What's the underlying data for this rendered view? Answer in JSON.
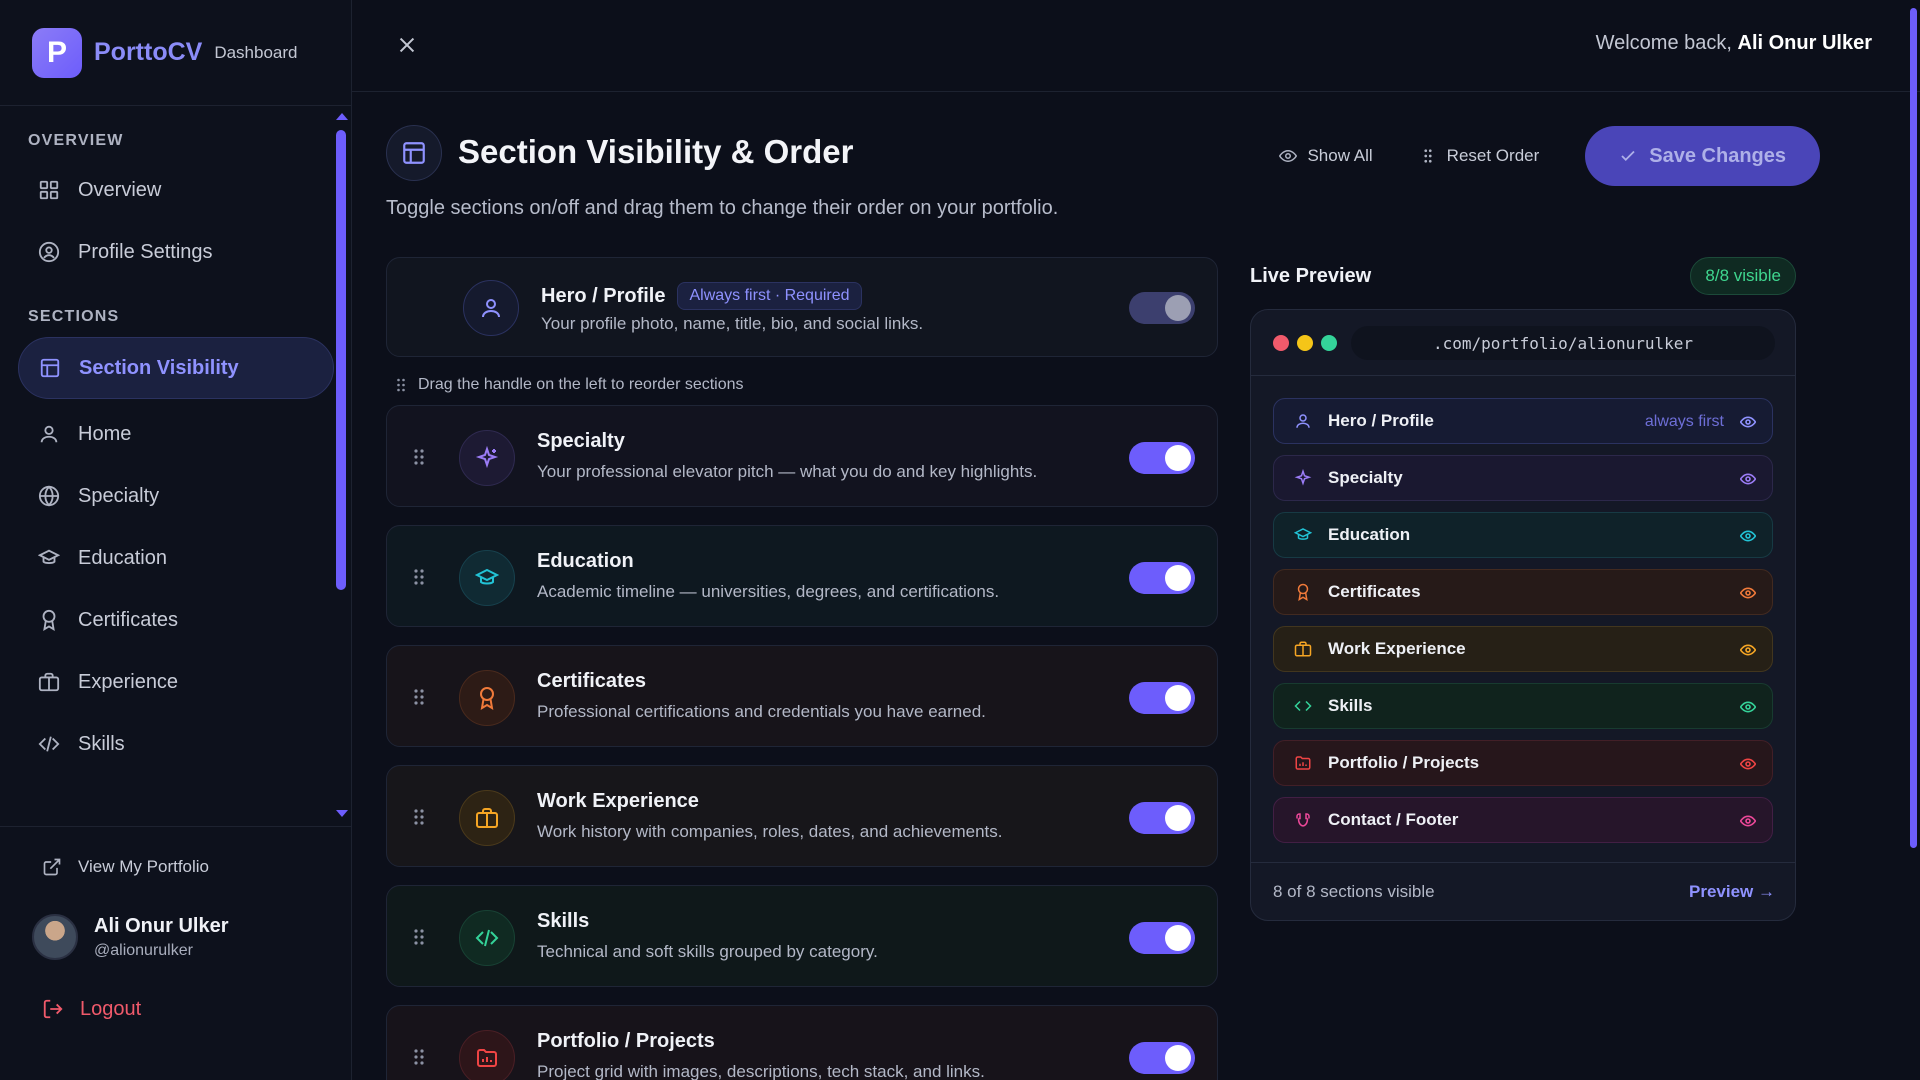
{
  "brand": {
    "logo_letter": "P",
    "name": "PorttoCV",
    "subtitle": "Dashboard"
  },
  "sidebar": {
    "overview_title": "OVERVIEW",
    "overview_items": [
      {
        "label": "Overview",
        "icon": "grid-icon"
      },
      {
        "label": "Profile Settings",
        "icon": "user-circle-icon"
      }
    ],
    "sections_title": "SECTIONS",
    "section_items": [
      {
        "label": "Section Visibility",
        "icon": "layout-icon",
        "active": true
      },
      {
        "label": "Home",
        "icon": "user-icon"
      },
      {
        "label": "Specialty",
        "icon": "globe-icon"
      },
      {
        "label": "Education",
        "icon": "graduation-cap-icon"
      },
      {
        "label": "Certificates",
        "icon": "award-icon"
      },
      {
        "label": "Experience",
        "icon": "briefcase-icon"
      },
      {
        "label": "Skills",
        "icon": "code-icon"
      }
    ],
    "view_portfolio": "View My Portfolio",
    "user": {
      "name": "Ali Onur Ulker",
      "handle": "@alionurulker"
    },
    "logout": "Logout"
  },
  "header": {
    "welcome_prefix": "Welcome back,",
    "welcome_name": "Ali Onur Ulker"
  },
  "page": {
    "title": "Section Visibility & Order",
    "subtitle": "Toggle sections on/off and drag them to change their order on your portfolio.",
    "show_all": "Show All",
    "reset_order": "Reset Order",
    "save": "Save Changes",
    "drag_hint": "Drag the handle on the left to reorder sections"
  },
  "hero": {
    "title": "Hero / Profile",
    "badge": "Always first · Required",
    "desc": "Your profile photo, name, title, bio, and social links."
  },
  "sections": [
    {
      "title": "Specialty",
      "desc": "Your professional elevator pitch — what you do and key highlights.",
      "accent": "#9b7cf6",
      "enabled": true
    },
    {
      "title": "Education",
      "desc": "Academic timeline — universities, degrees, and certifications.",
      "accent": "#22c3d6",
      "enabled": true
    },
    {
      "title": "Certificates",
      "desc": "Professional certifications and credentials you have earned.",
      "accent": "#f07a3a",
      "enabled": true
    },
    {
      "title": "Work Experience",
      "desc": "Work history with companies, roles, dates, and achievements.",
      "accent": "#f5a524",
      "enabled": true
    },
    {
      "title": "Skills",
      "desc": "Technical and soft skills grouped by category.",
      "accent": "#34d399",
      "enabled": true
    },
    {
      "title": "Portfolio / Projects",
      "desc": "Project grid with images, descriptions, tech stack, and links.",
      "accent": "#ef4444",
      "enabled": true
    }
  ],
  "preview": {
    "title": "Live Preview",
    "visible_badge": "8/8 visible",
    "url": ".com/portfolio/alionurulker",
    "rows": [
      {
        "label": "Hero / Profile",
        "note": "always first",
        "accent": "#8f92ff"
      },
      {
        "label": "Specialty",
        "accent": "#9b7cf6"
      },
      {
        "label": "Education",
        "accent": "#22c3d6"
      },
      {
        "label": "Certificates",
        "accent": "#f07a3a"
      },
      {
        "label": "Work Experience",
        "accent": "#f5a524"
      },
      {
        "label": "Skills",
        "accent": "#34d399"
      },
      {
        "label": "Portfolio / Projects",
        "accent": "#ef4444"
      },
      {
        "label": "Contact / Footer",
        "accent": "#ec4899"
      }
    ],
    "footer_text": "8 of 8 sections visible",
    "footer_link": "Preview →"
  },
  "colors": {
    "accent": "#6d5dfc",
    "background": "#0c0f1a",
    "success": "#3fd68f",
    "danger": "#f05a6b"
  }
}
